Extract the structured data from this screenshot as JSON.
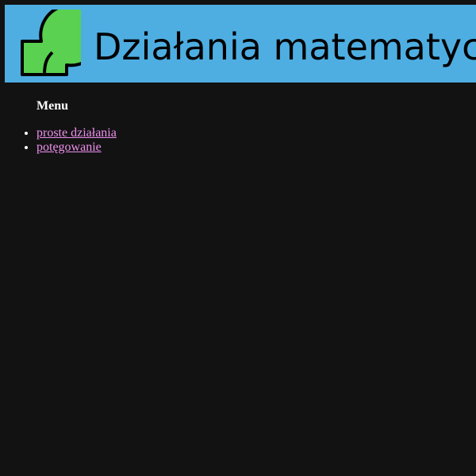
{
  "header": {
    "title": "Działania matematyczne",
    "logo_icon": "green-blob-logo-icon",
    "background_color": "#4eaee2",
    "logo_color": "#5ad150"
  },
  "menu": {
    "heading": "Menu",
    "items": [
      {
        "label": "proste działania"
      },
      {
        "label": "potęgowanie"
      }
    ],
    "link_color": "#ee90ee"
  },
  "page": {
    "background_color": "#121212"
  }
}
